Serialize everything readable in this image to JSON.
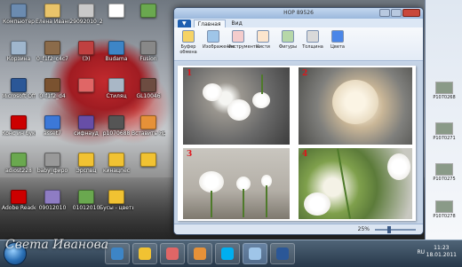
{
  "desktop": {
    "icons": [
      {
        "label": "Компьютер",
        "color": "#6b8bb0"
      },
      {
        "label": "Елена Иванова",
        "color": "#e9c46a"
      },
      {
        "label": "29092010_2",
        "color": "#c9c9c9"
      },
      {
        "label": "",
        "color": "#ffffff"
      },
      {
        "label": "",
        "color": "#6aa84f"
      },
      {
        "label": "Корзина",
        "color": "#9fb6cd"
      },
      {
        "label": "0_f1f2_c4c7",
        "color": "#8b6b4a"
      },
      {
        "label": "(Э)",
        "color": "#c04040"
      },
      {
        "label": "Budama",
        "color": "#3d85c6"
      },
      {
        "label": "Fusion",
        "color": "#888888"
      },
      {
        "label": "Microsoft Office Word",
        "color": "#2b5797"
      },
      {
        "label": "0_f1f2_d4",
        "color": "#7a5230"
      },
      {
        "label": "",
        "color": "#e06666"
      },
      {
        "label": "Стиляц",
        "color": "#a9b7c6"
      },
      {
        "label": "GL10046",
        "color": "#6d4c41"
      },
      {
        "label": "Конс ин букин ма",
        "color": "#cc0000"
      },
      {
        "label": "asset7",
        "color": "#3c78d8"
      },
      {
        "label": "сифнауд",
        "color": "#674ea7"
      },
      {
        "label": "p1070688",
        "color": "#555555"
      },
      {
        "label": "Вставить Ярлык",
        "color": "#e69138"
      },
      {
        "label": "adiost228",
        "color": "#6aa84f"
      },
      {
        "label": "baby_фиро",
        "color": "#999999"
      },
      {
        "label": "Эрспвц",
        "color": "#f1c232"
      },
      {
        "label": "кинацпес",
        "color": "#f1c232"
      },
      {
        "label": "",
        "color": "#f1c232"
      },
      {
        "label": "Adobe Reader",
        "color": "#cc0000"
      },
      {
        "label": "09012010",
        "color": "#8e7cc3"
      },
      {
        "label": "01012010",
        "color": "#6aa84f"
      },
      {
        "label": "Бусы - цветы",
        "color": "#f1c232"
      }
    ]
  },
  "paint": {
    "title": "HOP 89526",
    "file_tab": "▼",
    "tabs": [
      "Главная",
      "Вид"
    ],
    "active_tab": "Главная",
    "ribbon": [
      {
        "label": "Буфер обмена",
        "color": "#f6d365"
      },
      {
        "label": "Изображение",
        "color": "#9fc5e8"
      },
      {
        "label": "Инструменты",
        "color": "#f4cccc"
      },
      {
        "label": "Кисти",
        "color": "#fce5cd"
      },
      {
        "label": "Фигуры",
        "color": "#b6d7a8"
      },
      {
        "label": "Толщина",
        "color": "#d9d9d9"
      },
      {
        "label": "Цвета",
        "color": "#4a86e8"
      }
    ],
    "photos": [
      {
        "number": "1"
      },
      {
        "number": "2"
      },
      {
        "number": "3"
      },
      {
        "number": "4"
      }
    ],
    "zoom": "25%"
  },
  "rightpanel": {
    "items": [
      "P1070268",
      "P1070271",
      "P1070275",
      "P1070278"
    ]
  },
  "taskbar": {
    "buttons": [
      {
        "name": "ie",
        "color": "#3d85c6"
      },
      {
        "name": "explorer",
        "color": "#f1c232"
      },
      {
        "name": "media",
        "color": "#e06666"
      },
      {
        "name": "firefox",
        "color": "#e69138"
      },
      {
        "name": "skype",
        "color": "#00aff0"
      },
      {
        "name": "paint",
        "color": "#9fc5e8"
      },
      {
        "name": "word",
        "color": "#2b5797"
      }
    ],
    "tray": "RU",
    "time": "11:23",
    "date": "18.01.2011"
  },
  "watermark": "Света Иванова"
}
